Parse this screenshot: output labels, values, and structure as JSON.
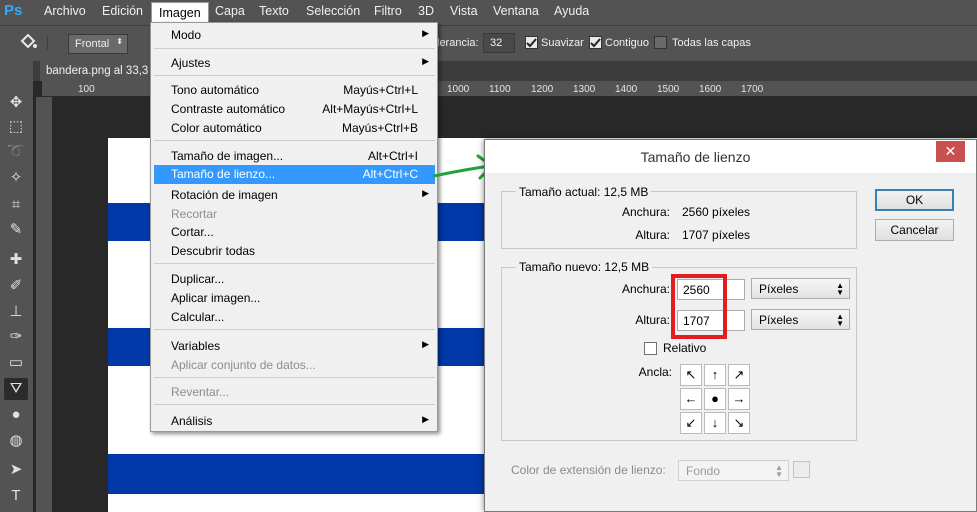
{
  "app": {
    "logo": "Ps"
  },
  "menubar": {
    "items": [
      "Archivo",
      "Edición",
      "Imagen",
      "Capa",
      "Texto",
      "Selección",
      "Filtro",
      "3D",
      "Vista",
      "Ventana",
      "Ayuda"
    ]
  },
  "options_bar": {
    "tool_icon": "paint-bucket-icon",
    "fill_source": "Frontal",
    "tolerance_label": "lerancia:",
    "tolerance_value": "32",
    "antialias_label": "Suavizar",
    "contiguous_label": "Contiguo",
    "all_layers_label": "Todas las capas"
  },
  "document": {
    "tab_title": "bandera.png al 33,3",
    "ruler_ticks": [
      "100",
      "1000",
      "1100",
      "1200",
      "1300",
      "1400",
      "1500",
      "1600",
      "1700"
    ]
  },
  "imagen_menu": {
    "items": [
      {
        "label": "Modo",
        "shortcut": "",
        "submenu": true,
        "disabled": false,
        "highlight": false
      },
      {
        "label": "Ajustes",
        "shortcut": "",
        "submenu": true,
        "disabled": false,
        "highlight": false
      },
      {
        "label": "Tono automático",
        "shortcut": "Mayús+Ctrl+L",
        "submenu": false,
        "disabled": false,
        "highlight": false
      },
      {
        "label": "Contraste automático",
        "shortcut": "Alt+Mayús+Ctrl+L",
        "submenu": false,
        "disabled": false,
        "highlight": false
      },
      {
        "label": "Color automático",
        "shortcut": "Mayús+Ctrl+B",
        "submenu": false,
        "disabled": false,
        "highlight": false
      },
      {
        "label": "Tamaño de imagen...",
        "shortcut": "Alt+Ctrl+I",
        "submenu": false,
        "disabled": false,
        "highlight": false
      },
      {
        "label": "Tamaño de lienzo...",
        "shortcut": "Alt+Ctrl+C",
        "submenu": false,
        "disabled": false,
        "highlight": true
      },
      {
        "label": "Rotación de imagen",
        "shortcut": "",
        "submenu": true,
        "disabled": false,
        "highlight": false
      },
      {
        "label": "Recortar",
        "shortcut": "",
        "submenu": false,
        "disabled": true,
        "highlight": false
      },
      {
        "label": "Cortar...",
        "shortcut": "",
        "submenu": false,
        "disabled": false,
        "highlight": false
      },
      {
        "label": "Descubrir todas",
        "shortcut": "",
        "submenu": false,
        "disabled": false,
        "highlight": false
      },
      {
        "label": "Duplicar...",
        "shortcut": "",
        "submenu": false,
        "disabled": false,
        "highlight": false
      },
      {
        "label": "Aplicar imagen...",
        "shortcut": "",
        "submenu": false,
        "disabled": false,
        "highlight": false
      },
      {
        "label": "Calcular...",
        "shortcut": "",
        "submenu": false,
        "disabled": false,
        "highlight": false
      },
      {
        "label": "Variables",
        "shortcut": "",
        "submenu": true,
        "disabled": false,
        "highlight": false
      },
      {
        "label": "Aplicar conjunto de datos...",
        "shortcut": "",
        "submenu": false,
        "disabled": true,
        "highlight": false
      },
      {
        "label": "Reventar...",
        "shortcut": "",
        "submenu": false,
        "disabled": true,
        "highlight": false
      },
      {
        "label": "Análisis",
        "shortcut": "",
        "submenu": true,
        "disabled": false,
        "highlight": false
      }
    ]
  },
  "dialog": {
    "title": "Tamaño de lienzo",
    "close": "✕",
    "current_size": {
      "label": "Tamaño actual: 12,5 MB",
      "width_label": "Anchura:",
      "width_value": "2560 píxeles",
      "height_label": "Altura:",
      "height_value": "1707 píxeles"
    },
    "new_size": {
      "label": "Tamaño nuevo: 12,5 MB",
      "width_label": "Anchura:",
      "width_value": "2560",
      "height_label": "Altura:",
      "height_value": "1707",
      "unit": "Píxeles",
      "relative_label": "Relativo",
      "anchor_label": "Ancla:"
    },
    "extension_color_label": "Color de extensión de lienzo:",
    "extension_color_value": "Fondo",
    "ok_label": "OK",
    "cancel_label": "Cancelar"
  },
  "colors": {
    "highlight": "#3399ff",
    "flag_blue": "#0038a8",
    "annotation_red": "#e01e1e",
    "annotation_green": "#22a33a"
  }
}
